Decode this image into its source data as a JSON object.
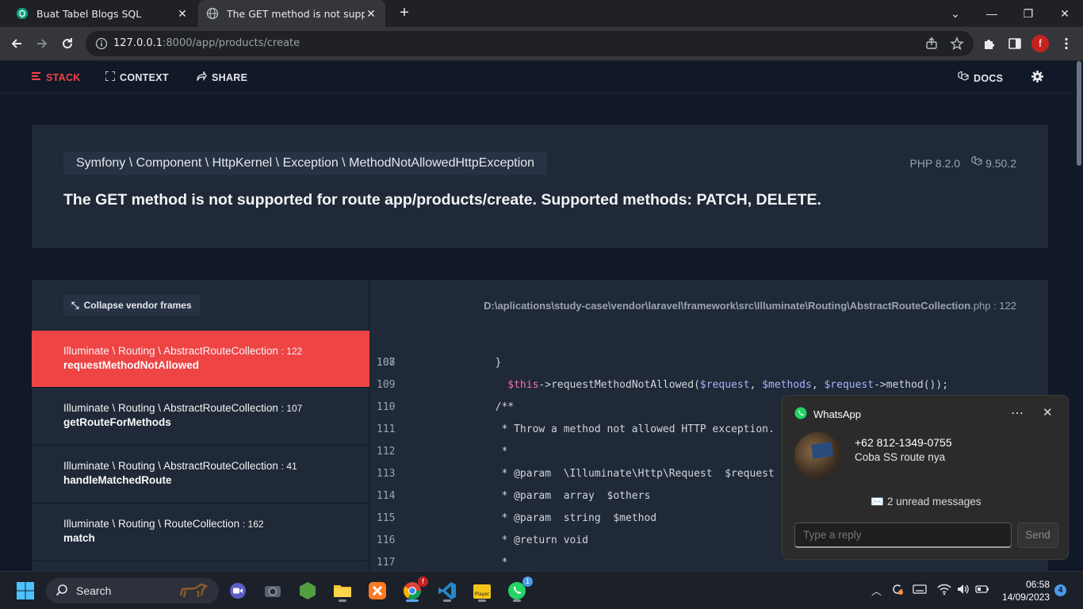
{
  "browser": {
    "tabs": [
      {
        "title": "Buat Tabel Blogs SQL",
        "icon": "chatgpt-icon"
      },
      {
        "title": "The GET method is not supported",
        "icon": "globe-icon"
      }
    ],
    "url_host": "127.0.0.1",
    "url_rest": ":8000/app/products/create",
    "profile_initial": "f"
  },
  "ignition": {
    "nav": {
      "stack": "STACK",
      "context": "CONTEXT",
      "share": "SHARE",
      "docs": "DOCS"
    },
    "exception_class": "Symfony \\ Component \\ HttpKernel \\ Exception \\ MethodNotAllowedHttpException",
    "message": "The GET method is not supported for route app/products/create. Supported methods: PATCH, DELETE.",
    "php_version": "PHP 8.2.0",
    "laravel_version": "9.50.2",
    "collapse_label": "Collapse vendor frames",
    "frames": [
      {
        "class": "Illuminate \\ Routing \\ AbstractRouteCollection",
        "line": ": 122",
        "method": "requestMethodNotAllowed"
      },
      {
        "class": "Illuminate \\ Routing \\ AbstractRouteCollection",
        "line": ": 107",
        "method": "getRouteForMethods"
      },
      {
        "class": "Illuminate \\ Routing \\ AbstractRouteCollection",
        "line": ": 41",
        "method": "handleMatchedRoute"
      },
      {
        "class": "Illuminate \\ Routing \\ RouteCollection",
        "line": ": 162",
        "method": "match"
      }
    ],
    "file_path": "D:\\aplications\\study-case\\vendor\\laravel\\framework\\src\\Illuminate\\Routing\\AbstractRouteCollection",
    "file_ext": ".php",
    "file_line": " : 122",
    "code_lines": [
      {
        "no": "107",
        "text": ""
      },
      {
        "no": "108",
        "text": "        }"
      },
      {
        "no": "109",
        "text": ""
      },
      {
        "no": "110",
        "text": "        /**"
      },
      {
        "no": "111",
        "text": "         * Throw a method not allowed HTTP exception."
      },
      {
        "no": "112",
        "text": "         *"
      },
      {
        "no": "113",
        "text": "         * @param  \\Illuminate\\Http\\Request  $request"
      },
      {
        "no": "114",
        "text": "         * @param  array  $others"
      },
      {
        "no": "115",
        "text": "         * @param  string  $method"
      },
      {
        "no": "116",
        "text": "         * @return void"
      },
      {
        "no": "117",
        "text": "         *"
      }
    ],
    "line107": {
      "this": "$this",
      "call": "->requestMethodNotAllowed(",
      "req": "$request",
      "sep": ", ",
      "methods": "$methods",
      "sep2": ", ",
      "req2": "$request",
      "tail": "->method());"
    }
  },
  "whatsapp": {
    "app_name": "WhatsApp",
    "sender": "+62 812-1349-0755",
    "message": "Coba SS route nya",
    "unread": "✉️ 2 unread messages",
    "reply_placeholder": "Type a reply",
    "send": "Send"
  },
  "taskbar": {
    "search": "Search",
    "time": "06:58",
    "date": "14/09/2023",
    "notifications": "4",
    "chrome_badge": "f",
    "whatsapp_badge": "1"
  },
  "colors": {
    "accent_red": "#ef4444",
    "bg": "#111827",
    "card": "#1f2937"
  }
}
